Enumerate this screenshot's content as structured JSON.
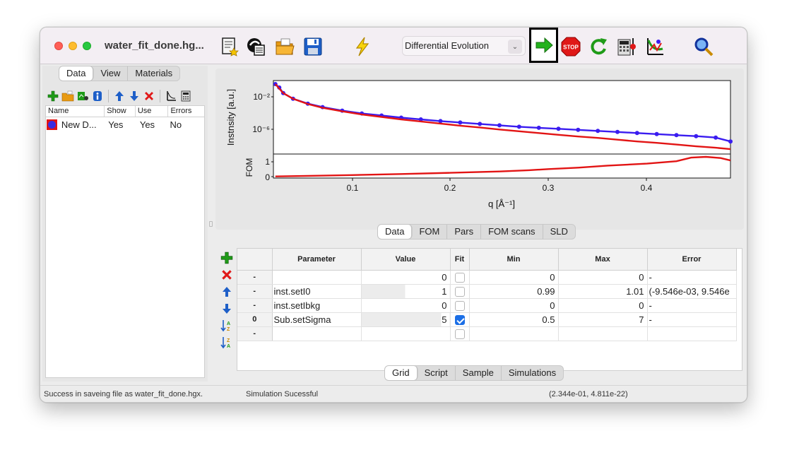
{
  "window": {
    "title": "water_fit_done.hg..."
  },
  "toolbar": {
    "algorithm_selected": "Differential Evolution",
    "buttons": [
      {
        "name": "new-model-icon"
      },
      {
        "name": "new-from-file-icon"
      },
      {
        "name": "open-folder-icon"
      },
      {
        "name": "save-disk-icon"
      },
      {
        "name": "simulate-lightning-icon"
      },
      {
        "name": "start-fit-arrow-icon"
      },
      {
        "name": "stop-sign-icon"
      },
      {
        "name": "restart-fit-icon"
      },
      {
        "name": "calculate-errors-icon"
      },
      {
        "name": "scan-parameter-icon"
      },
      {
        "name": "zoom-magnifier-icon"
      }
    ],
    "stop_label": "STOP"
  },
  "left_panel": {
    "tabs": [
      {
        "label": "Data",
        "active": true
      },
      {
        "label": "View",
        "active": false
      },
      {
        "label": "Materials",
        "active": false
      }
    ],
    "columns": [
      "Name",
      "Show",
      "Use",
      "Errors"
    ],
    "rows": [
      {
        "name": "New D...",
        "show": "Yes",
        "use": "Yes",
        "errors": "No",
        "color": "#3b2de0"
      }
    ]
  },
  "plot": {
    "top_ylabel": "Instnsity [a.u.]",
    "bottom_ylabel": "FOM",
    "xlabel": "q [Å⁻¹]",
    "top_yticks": [
      "10⁻²",
      "10⁻⁶"
    ],
    "bottom_yticks": [
      "1",
      "0"
    ],
    "xticks": [
      "0.1",
      "0.2",
      "0.3",
      "0.4"
    ]
  },
  "chart_data": {
    "type": "line",
    "xlabel": "q [Å⁻¹]",
    "ylabel": "Instnsity [a.u.]",
    "log_y": true,
    "xlim": [
      0.02,
      0.485
    ],
    "series": [
      {
        "color": "#3a1cf0",
        "markers": true,
        "x": [
          0.022,
          0.026,
          0.03,
          0.04,
          0.055,
          0.07,
          0.09,
          0.11,
          0.13,
          0.15,
          0.17,
          0.19,
          0.21,
          0.23,
          0.25,
          0.27,
          0.29,
          0.31,
          0.33,
          0.35,
          0.37,
          0.39,
          0.41,
          0.43,
          0.45,
          0.47,
          0.485
        ],
        "y": [
          -0.5,
          -1.0,
          -1.8,
          -2.6,
          -3.3,
          -3.8,
          -4.3,
          -4.7,
          -5.0,
          -5.3,
          -5.55,
          -5.8,
          -6.0,
          -6.2,
          -6.4,
          -6.6,
          -6.75,
          -6.9,
          -7.05,
          -7.2,
          -7.35,
          -7.5,
          -7.65,
          -7.8,
          -7.95,
          -8.15,
          -8.7
        ]
      },
      {
        "color": "#e21414",
        "markers": false,
        "x": [
          0.022,
          0.03,
          0.04,
          0.055,
          0.07,
          0.09,
          0.11,
          0.13,
          0.15,
          0.17,
          0.19,
          0.21,
          0.23,
          0.25,
          0.27,
          0.29,
          0.31,
          0.33,
          0.35,
          0.37,
          0.39,
          0.41,
          0.43,
          0.45,
          0.47,
          0.485
        ],
        "y": [
          -0.5,
          -1.8,
          -2.6,
          -3.35,
          -3.9,
          -4.4,
          -4.85,
          -5.2,
          -5.55,
          -5.85,
          -6.15,
          -6.45,
          -6.7,
          -7.0,
          -7.25,
          -7.5,
          -7.75,
          -8.0,
          -8.2,
          -8.45,
          -8.7,
          -8.9,
          -9.15,
          -9.4,
          -9.6,
          -9.8
        ]
      },
      {
        "name": "FOM",
        "color": "#e21414",
        "markers": false,
        "x": [
          0.022,
          0.06,
          0.1,
          0.15,
          0.2,
          0.25,
          0.28,
          0.3,
          0.33,
          0.36,
          0.4,
          0.43,
          0.445,
          0.46,
          0.475,
          0.485
        ],
        "y": [
          0.0,
          0.08,
          0.17,
          0.3,
          0.45,
          0.62,
          0.78,
          0.92,
          1.1,
          1.35,
          1.6,
          1.9,
          2.35,
          2.45,
          2.3,
          2.0
        ]
      }
    ]
  },
  "plot_tabs": [
    {
      "label": "Data",
      "active": true
    },
    {
      "label": "FOM",
      "active": false
    },
    {
      "label": "Pars",
      "active": false
    },
    {
      "label": "FOM scans",
      "active": false
    },
    {
      "label": "SLD",
      "active": false
    }
  ],
  "grid": {
    "headers": [
      "Parameter",
      "Value",
      "Fit",
      "Min",
      "Max",
      "Error"
    ],
    "rows": [
      {
        "header": "-",
        "parameter": "",
        "value": "0",
        "fit": false,
        "min": "0",
        "max": "0",
        "error": "-"
      },
      {
        "header": "-",
        "parameter": "inst.setI0",
        "value": "1",
        "fit": false,
        "min": "0.99",
        "max": "1.01",
        "error": "(-9.546e-03, 9.546e"
      },
      {
        "header": "-",
        "parameter": "inst.setIbkg",
        "value": "0",
        "fit": false,
        "min": "0",
        "max": "0",
        "error": "-"
      },
      {
        "header": "0",
        "parameter": "Sub.setSigma",
        "value": "5",
        "fit": true,
        "min": "0.5",
        "max": "7",
        "error": "-"
      },
      {
        "header": "-",
        "parameter": "",
        "value": "",
        "fit": false,
        "min": "",
        "max": "",
        "error": ""
      }
    ]
  },
  "grid_tabs": [
    {
      "label": "Grid",
      "active": true
    },
    {
      "label": "Script",
      "active": false
    },
    {
      "label": "Sample",
      "active": false
    },
    {
      "label": "Simulations",
      "active": false
    }
  ],
  "status": {
    "left": "Success in saveing file as water_fit_done.hgx.",
    "middle": "Simulation Sucessful",
    "right": "(2.344e-01, 4.811e-22)"
  }
}
